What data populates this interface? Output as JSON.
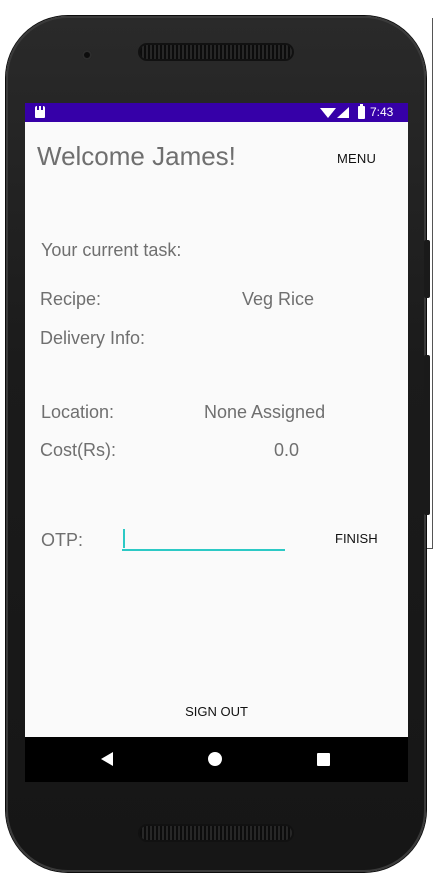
{
  "status_bar": {
    "time": "7:43",
    "icons": [
      "sd-card-icon",
      "wifi-icon",
      "signal-icon",
      "battery-icon"
    ],
    "color": "#3600a8"
  },
  "header": {
    "title": "Welcome James!",
    "menu_label": "MENU"
  },
  "task": {
    "heading": "Your current task:",
    "recipe_label": "Recipe:",
    "recipe_value": "Veg Rice",
    "delivery_label": "Delivery Info:",
    "location_label": "Location:",
    "location_value": "None Assigned",
    "cost_label": "Cost(Rs):",
    "cost_value": "0.0"
  },
  "otp": {
    "label": "OTP:",
    "value": "",
    "accent_color": "#2cc9c5",
    "finish_label": "FINISH"
  },
  "footer": {
    "signout_label": "SIGN OUT"
  },
  "nav": {
    "icons": [
      "back-icon",
      "home-icon",
      "recents-icon"
    ]
  }
}
